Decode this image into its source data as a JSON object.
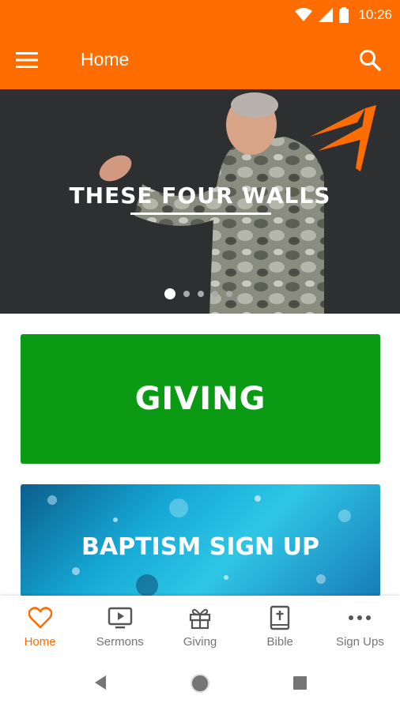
{
  "status_bar": {
    "time": "10:26"
  },
  "app_bar": {
    "title": "Home"
  },
  "hero": {
    "title": "THESE FOUR WALLS",
    "slide_count": 5,
    "active_slide": 1
  },
  "cards": {
    "giving": "GIVING",
    "baptism": "BAPTISM SIGN UP"
  },
  "bottom_nav": {
    "items": [
      {
        "label": "Home",
        "icon": "heart-icon",
        "active": true
      },
      {
        "label": "Sermons",
        "icon": "tv-play-icon",
        "active": false
      },
      {
        "label": "Giving",
        "icon": "gift-icon",
        "active": false
      },
      {
        "label": "Bible",
        "icon": "bible-icon",
        "active": false
      },
      {
        "label": "Sign Ups",
        "icon": "more-icon",
        "active": false
      }
    ]
  },
  "colors": {
    "brand": "#ff6d00",
    "giving_green": "#0b9a14",
    "inactive_nav": "#757575"
  }
}
